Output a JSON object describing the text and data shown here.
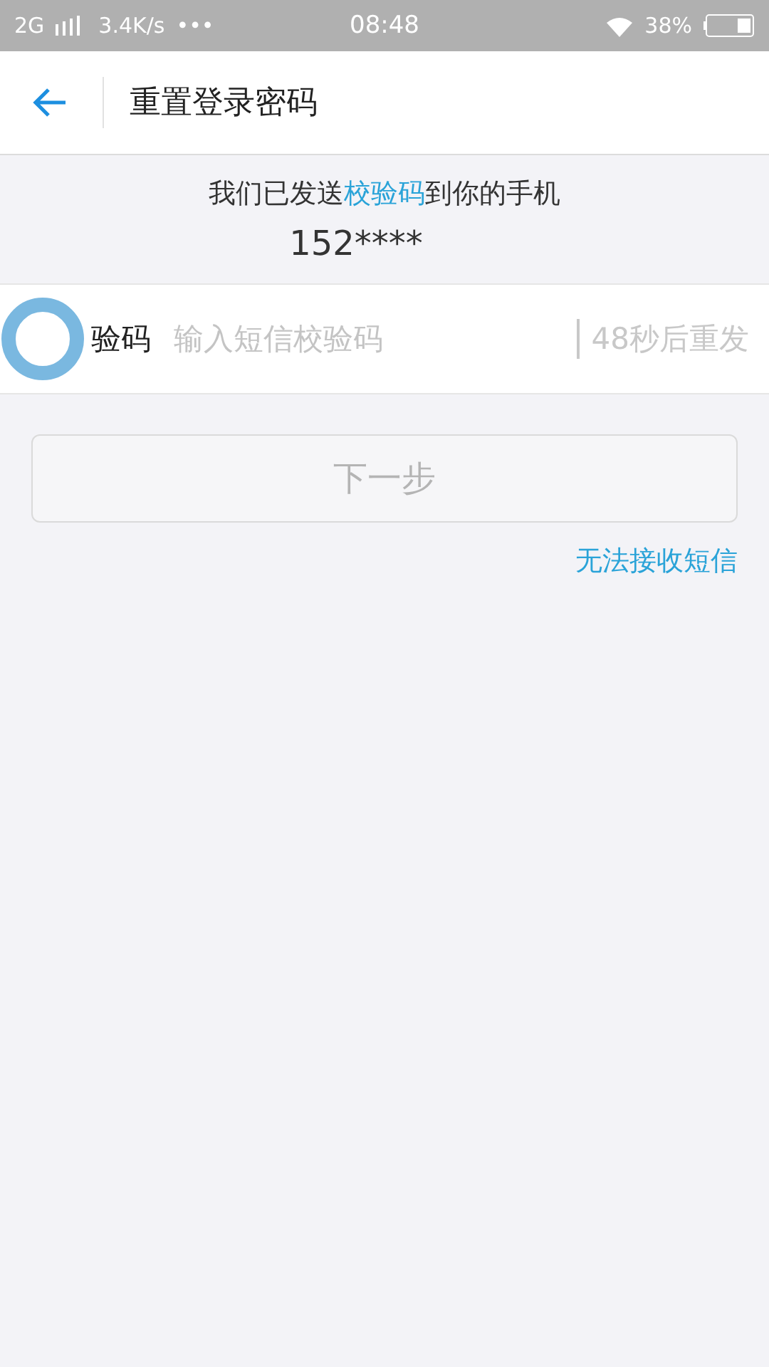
{
  "status_bar": {
    "network": "2G",
    "speed": "3.4K/s",
    "more": "•••",
    "time": "08:48",
    "battery": "38%"
  },
  "header": {
    "title": "重置登录密码"
  },
  "notice": {
    "parts": [
      {
        "text": "我们已发送",
        "highlight": false
      },
      {
        "text": "校验码",
        "highlight": true
      },
      {
        "text": "到你的手机",
        "highlight": false
      }
    ],
    "phone": "152****"
  },
  "code_row": {
    "label": "验码",
    "placeholder": "输入短信校验码",
    "resend": {
      "label": "48秒后重发",
      "disabled": true
    }
  },
  "next_button": {
    "label": "下一步",
    "disabled": true
  },
  "help_link": "无法接收短信"
}
